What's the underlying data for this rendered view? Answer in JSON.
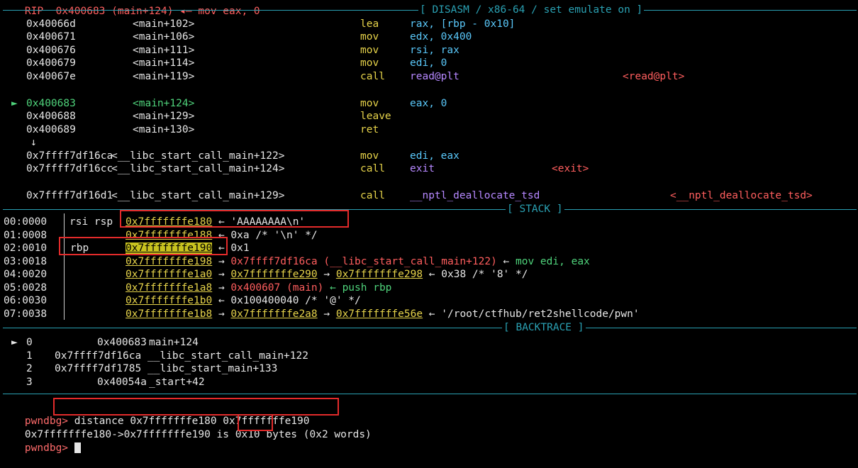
{
  "top_cut": "RIP  0x400683 (main+124) ◂— mov eax, 0",
  "disasm_label": "[ DISASM / x86-64 / set emulate on ]",
  "stack_label": "[ STACK ]",
  "backtrace_label": "[ BACKTRACE ]",
  "disasm": [
    {
      "marker": "",
      "addr": "0x40066d",
      "sym": "<main+102>",
      "mn": "lea",
      "op": "rax, [rbp - 0x10]",
      "note": ""
    },
    {
      "marker": "",
      "addr": "0x400671",
      "sym": "<main+106>",
      "mn": "mov",
      "op": "edx, 0x400",
      "note": ""
    },
    {
      "marker": "",
      "addr": "0x400676",
      "sym": "<main+111>",
      "mn": "mov",
      "op": "rsi, rax",
      "note": ""
    },
    {
      "marker": "",
      "addr": "0x400679",
      "sym": "<main+114>",
      "mn": "mov",
      "op": "edi, 0",
      "note": ""
    },
    {
      "marker": "",
      "addr": "0x40067e",
      "sym": "<main+119>",
      "mn": "call",
      "op": "read@plt",
      "note": "<read@plt>"
    },
    {
      "marker": "►",
      "addr": "0x400683",
      "sym": "<main+124>",
      "mn": "mov",
      "op": "eax, 0",
      "note": ""
    },
    {
      "marker": "",
      "addr": "0x400688",
      "sym": "<main+129>",
      "mn": "leave",
      "op": "",
      "note": ""
    },
    {
      "marker": "",
      "addr": "0x400689",
      "sym": "<main+130>",
      "mn": "ret",
      "op": "",
      "note": ""
    },
    {
      "marker": "",
      "addr": "↓",
      "sym": "",
      "mn": "",
      "op": "",
      "note": ""
    },
    {
      "marker": "",
      "addr": "0x7ffff7df16ca",
      "sym": "<__libc_start_call_main+122>",
      "mn": "mov",
      "op": "edi, eax",
      "note": ""
    },
    {
      "marker": "",
      "addr": "0x7ffff7df16cc",
      "sym": "<__libc_start_call_main+124>",
      "mn": "call",
      "op": "exit",
      "note": "<exit>"
    },
    {
      "marker": "",
      "addr": "0x7ffff7df16d1",
      "sym": "<__libc_start_call_main+129>",
      "mn": "call",
      "op": "__nptl_deallocate_tsd",
      "note": "<__nptl_deallocate_tsd>"
    }
  ],
  "stack": [
    {
      "off": "00:0000",
      "regs": "rsi rsp",
      "addr": "0x7fffffffe180",
      "rest": " ← 'AAAAAAAA\\n'"
    },
    {
      "off": "01:0008",
      "regs": "",
      "addr": "0x7fffffffe188",
      "rest": " ← 0xa /* '\\n' */"
    },
    {
      "off": "02:0010",
      "regs": "rbp",
      "addr": "0x7fffffffe190",
      "rest": " ← 0x1"
    },
    {
      "off": "03:0018",
      "regs": "",
      "addr": "0x7fffffffe198",
      "rest_a": " → ",
      "rest_b": "0x7ffff7df16ca (__libc_start_call_main+122)",
      "rest_c": " ← ",
      "rest_d": "mov edi, eax"
    },
    {
      "off": "04:0020",
      "regs": "",
      "addr": "0x7fffffffe1a0",
      "rest_a": " → ",
      "rest_b": "0x7fffffffe290",
      "rest_c": " → ",
      "rest_d": "0x7fffffffe298",
      "rest_e": " ← 0x38 /* '8' */"
    },
    {
      "off": "05:0028",
      "regs": "",
      "addr": "0x7fffffffe1a8",
      "rest_a": " → ",
      "rest_b": "0x400607 (main)",
      "rest_c": " ← push rbp"
    },
    {
      "off": "06:0030",
      "regs": "",
      "addr": "0x7fffffffe1b0",
      "rest": " ← 0x100400040 /* '@' */"
    },
    {
      "off": "07:0038",
      "regs": "",
      "addr": "0x7fffffffe1b8",
      "rest_a": " → ",
      "rest_b": "0x7fffffffe2a8",
      "rest_c": " → ",
      "rest_d": "0x7fffffffe56e",
      "rest_e": " ← '/root/ctfhub/ret2shellcode/pwn'"
    }
  ],
  "backtrace": [
    {
      "marker": "►",
      "idx": "0",
      "addr": "0x400683",
      "sym": "main+124"
    },
    {
      "marker": "",
      "idx": "1",
      "addr": "0x7ffff7df16ca",
      "sym": "__libc_start_call_main+122"
    },
    {
      "marker": "",
      "idx": "2",
      "addr": "0x7ffff7df1785",
      "sym": "__libc_start_main+133"
    },
    {
      "marker": "",
      "idx": "3",
      "addr": "0x40054a",
      "sym": "_start+42"
    }
  ],
  "prompt": "pwndbg>",
  "command": "distance 0x7fffffffe180 0x7fffffffe190",
  "result_pre": "0x7fffffffe180->0x7fffffffe190 is ",
  "result_val": "0x10",
  "result_post": " bytes (0x2 words)",
  "colors": {
    "separator": "#2aa1b3",
    "highlight_box": "#e32b2b",
    "current": "#4fd37b"
  }
}
